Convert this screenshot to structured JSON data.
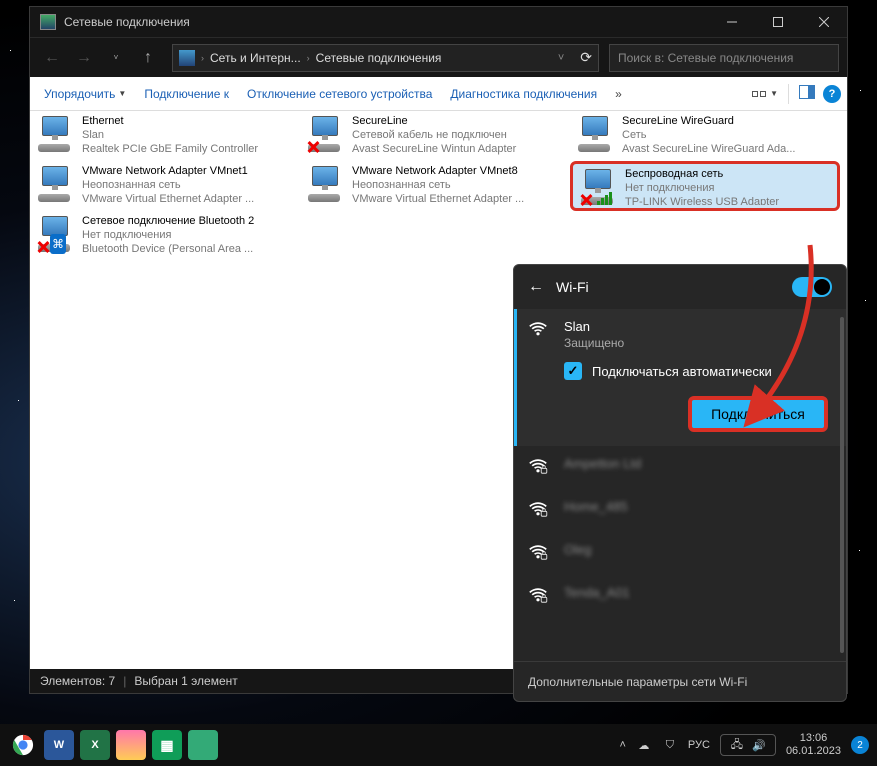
{
  "window": {
    "title": "Сетевые подключения"
  },
  "breadcrumb": {
    "root": "Сеть и Интерн...",
    "current": "Сетевые подключения"
  },
  "search": {
    "placeholder": "Поиск в: Сетевые подключения"
  },
  "toolbar": {
    "organize": "Упорядочить",
    "connect_to": "Подключение к",
    "disable": "Отключение сетевого устройства",
    "diagnose": "Диагностика подключения"
  },
  "adapters": [
    {
      "name": "Ethernet",
      "status": "Slan",
      "device": "Realtek PCIe GbE Family Controller",
      "redx": false,
      "bt": false,
      "wifi": false
    },
    {
      "name": "SecureLine",
      "status": "Сетевой кабель не подключен",
      "device": "Avast SecureLine Wintun Adapter",
      "redx": true,
      "bt": false,
      "wifi": false
    },
    {
      "name": "SecureLine WireGuard",
      "status": "Сеть",
      "device": "Avast SecureLine WireGuard Ada...",
      "redx": false,
      "bt": false,
      "wifi": false
    },
    {
      "name": "VMware Network Adapter VMnet1",
      "status": "Неопознанная сеть",
      "device": "VMware Virtual Ethernet Adapter ...",
      "redx": false,
      "bt": false,
      "wifi": false
    },
    {
      "name": "VMware Network Adapter VMnet8",
      "status": "Неопознанная сеть",
      "device": "VMware Virtual Ethernet Adapter ...",
      "redx": false,
      "bt": false,
      "wifi": false
    },
    {
      "name": "Беспроводная сеть",
      "status": "Нет подключения",
      "device": "TP-LINK Wireless USB Adapter",
      "redx": true,
      "bt": false,
      "wifi": true,
      "selected": true,
      "highlight": true
    },
    {
      "name": "Сетевое подключение Bluetooth 2",
      "status": "Нет подключения",
      "device": "Bluetooth Device (Personal Area ...",
      "redx": true,
      "bt": true,
      "wifi": false
    }
  ],
  "statusbar": {
    "count": "Элементов: 7",
    "sel": "Выбран 1 элемент"
  },
  "popup": {
    "title": "Wi-Fi",
    "auto_label": "Подключаться автоматически",
    "connect": "Подключиться",
    "more": "Дополнительные параметры сети Wi-Fi",
    "nets": [
      {
        "name": "Slan",
        "sub": "Защищено",
        "active": true,
        "lock": false
      },
      {
        "name": "Ampetton Ltd",
        "blur": true,
        "lock": true
      },
      {
        "name": "Home_485",
        "blur": true,
        "lock": true
      },
      {
        "name": "Oleg",
        "blur": true,
        "lock": true
      },
      {
        "name": "Tenda_A01",
        "blur": true,
        "lock": true
      }
    ]
  },
  "tray": {
    "lang": "РУС",
    "time": "13:06",
    "date": "06.01.2023",
    "notif": "2"
  }
}
